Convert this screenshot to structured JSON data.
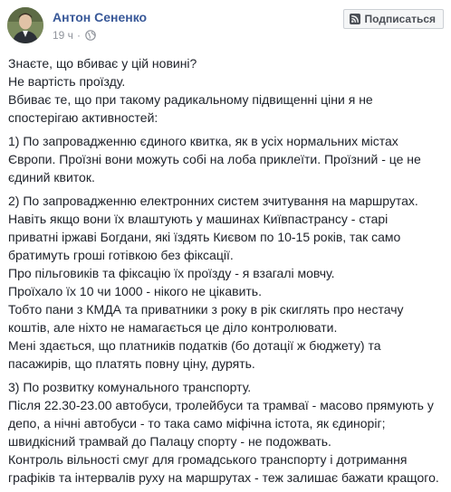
{
  "post": {
    "author": "Антон Сененко",
    "time": "19 ч",
    "separator": "·",
    "privacy_icon": "globe-icon",
    "subscribe_label": "Подписаться",
    "subscribe_icon": "rss-icon",
    "colors": {
      "author": "#385898",
      "meta": "#90949c",
      "text": "#1d2129",
      "button_bg": "#f5f6f7",
      "button_border": "#ccd0d5"
    }
  },
  "body": {
    "paragraphs": [
      {
        "lines": [
          "Знаєте, що вбиває у цій новині?",
          "Не вартість проїзду.",
          "Вбиває те, що при такому радикальному підвищенні ціни я не",
          "спостерігаю активностей:"
        ]
      },
      {
        "lines": [
          "1) По запровадженню єдиного квитка, як в усіх нормальних містах",
          "Європи. Проїзні вони можуть собі на лоба приклеїти. Проїзний - це не",
          "єдиний квиток."
        ]
      },
      {
        "lines": [
          "2) По запровадженню електронних систем зчитування на маршрутах.",
          "Навіть якщо вони їх влаштують у машинах Київпастрансу - старі",
          "приватні іржаві Богдани, які їздять Києвом по 10-15 років, так само",
          "братимуть гроші готівкою без фіксації.",
          "Про пільговиків та фіксацію їх проїзду - я взагалі мовчу.",
          "Проїхало їх 10 чи 1000 - нікого не цікавить.",
          "Тобто пани з КМДА та приватники з року в рік скиглять про нестачу",
          "коштів, але ніхто не намагається це діло контролювати.",
          "Мені здається, що платників податків (бо дотації ж бюджету) та",
          "пасажирів, що платять повну ціну, дурять."
        ]
      },
      {
        "lines": [
          "3) По розвитку комунального транспорту.",
          "Після 22.30-23.00 автобуси, тролейбуси та трамваї - масово прямують у",
          "депо, а нічні автобуси - то така само міфічна істота, як єдиноріг;",
          "швидкісний трамвай до Палацу спорту - не подожвать.",
          "Контроль вільності смуг для громадського транспорту і дотримання",
          "графіків та інтервалів руху на маршрутах - теж залишає бажати кращого."
        ]
      }
    ]
  }
}
